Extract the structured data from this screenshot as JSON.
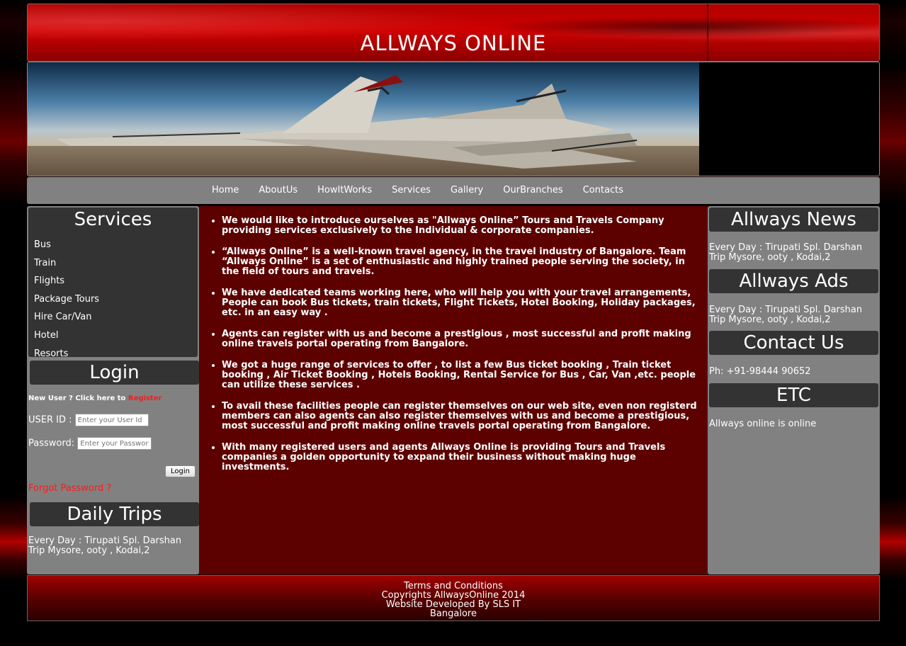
{
  "site_title": "ALLWAYS ONLINE",
  "nav": [
    "Home",
    "AboutUs",
    "HowItWorks",
    "Services",
    "Gallery",
    "OurBranches",
    "Contacts"
  ],
  "services": {
    "title": "Services",
    "items": [
      "Bus",
      "Train",
      "Flights",
      "Package Tours",
      "Hire Car/Van",
      "Hotel",
      "Resorts"
    ]
  },
  "login": {
    "title": "Login",
    "new_user_text": "New User ? Click here to",
    "register_link": "Register",
    "userid_label": "USER ID :",
    "userid_placeholder": "Enter your User Id",
    "password_label": "Password:",
    "password_placeholder": "Enter your Password",
    "login_button": "Login",
    "forgot_link": "Forgot Password ?"
  },
  "daily_trips": {
    "title": "Daily Trips",
    "text": "Every Day : Tirupati Spl. Darshan Trip Mysore, ooty , Kodai,2"
  },
  "intro_points": [
    "We would like to introduce ourselves as \"Allways Online” Tours and Travels Company providing services exclusively to the Individual & corporate companies.",
    "“Allways Online” is a well-known travel agency, in the travel industry of Bangalore. Team “Allways Online” is a set of enthusiastic and highly trained people serving the society, in the field of tours and travels.",
    "We have dedicated teams working here, who will help you with your travel arrangements, People can book Bus tickets, train tickets, Flight Tickets, Hotel Booking, Holiday packages, etc. in an easy way .",
    "Agents can register with us and become a prestigious , most successful and profit making online travels portal operating from Bangalore.",
    "We got a huge range of services to offer , to list a few Bus ticket booking , Train ticket booking , Air Ticket Booking , Hotels Booking, Rental Service for Bus , Car, Van ,etc. people can utilize these services .",
    "To avail these facilities people can register themselves on our web site, even non registerd members can also agents can also register themselves with us and become a prestigious, most successful and profit making online travels portal operating from Bangalore.",
    "With many registered users and agents Allways Online is providing Tours and Travels companies a golden opportunity to expand their business without making huge investments."
  ],
  "right": {
    "news_title": "Allways News",
    "news_text": "Every Day : Tirupati Spl. Darshan Trip Mysore, ooty , Kodai,2",
    "ads_title": "Allways Ads",
    "ads_text": "Every Day : Tirupati Spl. Darshan Trip Mysore, ooty , Kodai,2",
    "contact_title": "Contact Us",
    "contact_text": "Ph: +91-98444 90652",
    "etc_title": "ETC",
    "etc_text": "Allways online is online"
  },
  "footer": {
    "terms": "Terms and Conditions",
    "copyright": "Copyrights AllwaysOnline 2014",
    "developer": "Website Developed By SLS IT",
    "city": "Bangalore"
  },
  "colors": {
    "header_red": "#c00000",
    "nav_gray": "#818181",
    "panel_dark": "#333333",
    "content_maroon": "#5c0000",
    "link_red": "#ff1a1a"
  }
}
